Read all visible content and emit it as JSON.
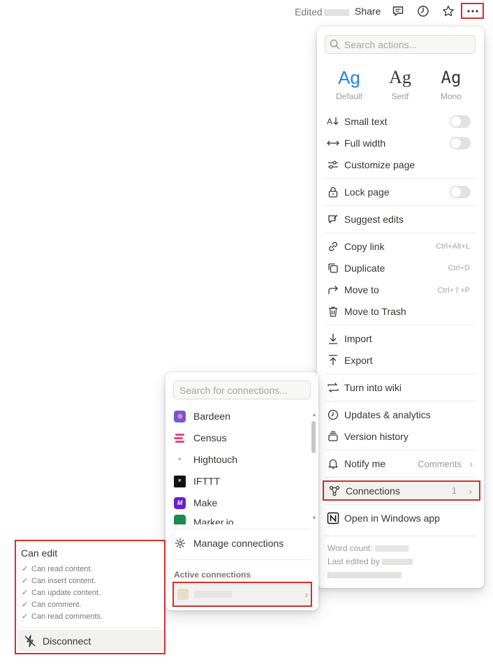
{
  "topbar": {
    "edited_label": "Edited",
    "share_label": "Share",
    "icons": [
      "comment-icon",
      "clock-icon",
      "star-icon",
      "more-icon"
    ]
  },
  "actions_menu": {
    "search_placeholder": "Search actions...",
    "fonts": [
      {
        "glyph": "Ag",
        "caption": "Default",
        "selected": true
      },
      {
        "glyph": "Ag",
        "caption": "Serif",
        "selected": false
      },
      {
        "glyph": "Ag",
        "caption": "Mono",
        "selected": false
      }
    ],
    "items": {
      "small_text": "Small text",
      "full_width": "Full width",
      "customize_page": "Customize page",
      "lock_page": "Lock page",
      "suggest_edits": "Suggest edits",
      "copy_link": "Copy link",
      "copy_link_shortcut": "Ctrl+Alt+L",
      "duplicate": "Duplicate",
      "duplicate_shortcut": "Ctrl+D",
      "move_to": "Move to",
      "move_to_shortcut": "Ctrl+⇧+P",
      "move_to_trash": "Move to Trash",
      "import": "Import",
      "export": "Export",
      "turn_into_wiki": "Turn into wiki",
      "updates_analytics": "Updates & analytics",
      "version_history": "Version history",
      "notify_me": "Notify me",
      "notify_me_value": "Comments",
      "connections": "Connections",
      "connections_count": "1",
      "open_in_app": "Open in Windows app"
    },
    "toggles": {
      "small_text": false,
      "full_width": false,
      "lock_page": false
    },
    "footer": {
      "word_count_label": "Word count:",
      "last_edited_label": "Last edited by"
    }
  },
  "connections_menu": {
    "search_placeholder": "Search for connections...",
    "integrations": [
      {
        "name": "Bardeen",
        "color": "#6b5bd6"
      },
      {
        "name": "Census",
        "color": "#ec3f83"
      },
      {
        "name": "Hightouch",
        "color": "#ffffff"
      },
      {
        "name": "IFTTT",
        "color": "#111111"
      },
      {
        "name": "Make",
        "color": "#6a1fd1"
      },
      {
        "name": "Marker.io",
        "color": "#1c8a4c"
      }
    ],
    "manage_label": "Manage connections",
    "active_label": "Active connections"
  },
  "permissions_panel": {
    "title": "Can edit",
    "permissions": [
      "Can read content.",
      "Can insert content.",
      "Can update content.",
      "Can comment.",
      "Can read comments."
    ],
    "disconnect_label": "Disconnect"
  }
}
